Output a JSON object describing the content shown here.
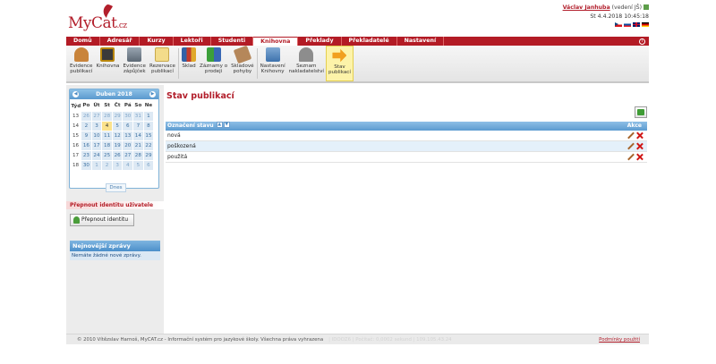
{
  "header": {
    "logo": "MyCat",
    "logo_suffix": ".cz",
    "user_name": "Václav Janhuba",
    "user_role": "(vedení JŠ)",
    "datetime": "St 4.4.2018 10:45:18",
    "flags": [
      "cz",
      "sk",
      "gb",
      "de"
    ]
  },
  "nav": {
    "items": [
      "Domů",
      "Adresář",
      "Kurzy",
      "Lektoři",
      "Studenti",
      "Knihovna",
      "Překlady",
      "Překladatelé",
      "Nastavení"
    ],
    "active_index": 5
  },
  "toolbar": {
    "items": [
      {
        "line1": "Evidence",
        "line2": "publikací",
        "icon": "book-cover-icon"
      },
      {
        "line1": "Knihovna",
        "line2": "",
        "icon": "library-icon"
      },
      {
        "line1": "Evidence",
        "line2": "zápůjček",
        "icon": "loans-icon"
      },
      {
        "line1": "Rezervace",
        "line2": "publikací",
        "icon": "folder-icon"
      },
      {
        "line1": "Sklad",
        "line2": "",
        "icon": "warehouse-icon"
      },
      {
        "line1": "Záznamy o",
        "line2": "prodeji",
        "icon": "sales-records-icon"
      },
      {
        "line1": "Skladové",
        "line2": "pohyby",
        "icon": "stock-movements-icon"
      },
      {
        "line1": "Nastavení",
        "line2": "Knihovny",
        "icon": "library-settings-icon"
      },
      {
        "line1": "Seznam",
        "line2": "nakladatelství",
        "icon": "publishers-icon"
      },
      {
        "line1": "Stav",
        "line2": "publikací",
        "icon": "arrow-right-icon"
      }
    ],
    "active_index": 9
  },
  "calendar": {
    "month_label": "Duben 2018",
    "headers": [
      "Týd",
      "Po",
      "Út",
      "St",
      "Čt",
      "Pá",
      "So",
      "Ne"
    ],
    "weeks": [
      {
        "wk": "13",
        "days": [
          "26",
          "27",
          "28",
          "29",
          "30",
          "31",
          "1"
        ],
        "other": [
          1,
          1,
          1,
          1,
          1,
          1,
          0
        ]
      },
      {
        "wk": "14",
        "days": [
          "2",
          "3",
          "4",
          "5",
          "6",
          "7",
          "8"
        ],
        "other": [
          0,
          0,
          0,
          0,
          0,
          0,
          0
        ]
      },
      {
        "wk": "15",
        "days": [
          "9",
          "10",
          "11",
          "12",
          "13",
          "14",
          "15"
        ],
        "other": [
          0,
          0,
          0,
          0,
          0,
          0,
          0
        ]
      },
      {
        "wk": "16",
        "days": [
          "16",
          "17",
          "18",
          "19",
          "20",
          "21",
          "22"
        ],
        "other": [
          0,
          0,
          0,
          0,
          0,
          0,
          0
        ]
      },
      {
        "wk": "17",
        "days": [
          "23",
          "24",
          "25",
          "26",
          "27",
          "28",
          "29"
        ],
        "other": [
          0,
          0,
          0,
          0,
          0,
          0,
          0
        ]
      },
      {
        "wk": "18",
        "days": [
          "30",
          "1",
          "2",
          "3",
          "4",
          "5",
          "6"
        ],
        "other": [
          0,
          1,
          1,
          1,
          1,
          1,
          1
        ]
      }
    ],
    "today": "4",
    "today_button": "Dnes"
  },
  "sidebar": {
    "switch_title": "Přepnout identitu uživatele",
    "switch_button": "Přepnout identitu",
    "news_title": "Nejnovější zprávy",
    "news_empty": "Nemáte žádné nové zprávy."
  },
  "content": {
    "title": "Stav publikací",
    "column_label": "Označení stavu",
    "actions_label": "Akce",
    "rows": [
      "nová",
      "poškozená",
      "použitá"
    ]
  },
  "footer": {
    "copyright": "© 2010 Vítězslav Harnoš, MyCAT.cz - Informační systém pro jazykové školy. Všechna práva vyhrazena",
    "technical": "|   IDOOZ6    |   Počítač: 0,0002 sekund   |   109.105.43.24",
    "terms": "Podmínky použití"
  },
  "colors": {
    "brand_red": "#b31b25",
    "header_blue": "#5c9bd0",
    "row_alt": "#e4f0fa",
    "active_tool": "#fdf3a9"
  }
}
